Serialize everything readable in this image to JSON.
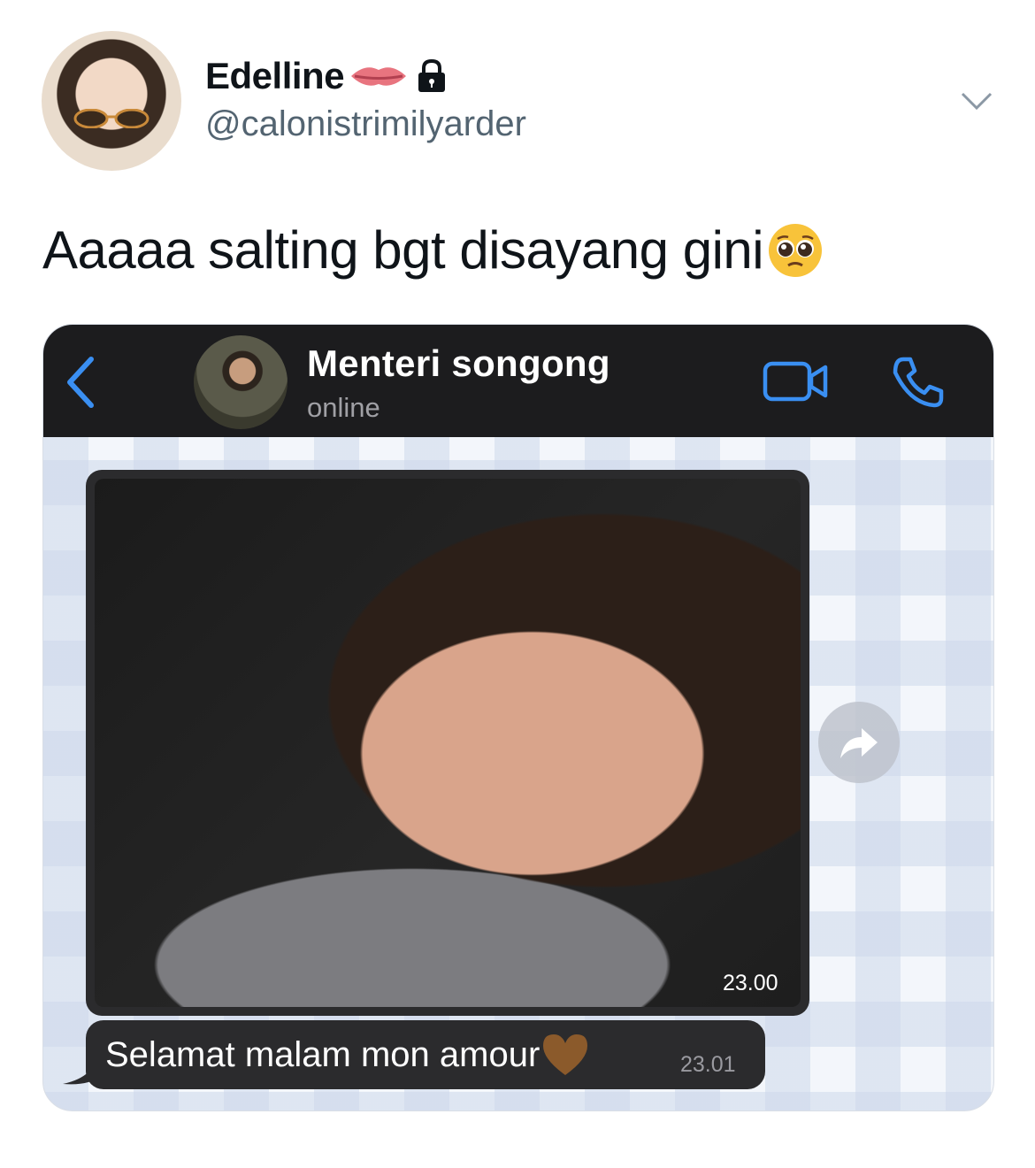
{
  "tweet": {
    "display_name": "Edelline",
    "handle": "@calonistrimilyarder",
    "text": "Aaaaa salting bgt disayang gini",
    "name_icons": [
      "lips-icon",
      "lock-icon"
    ],
    "text_emoji": "pleading-face-icon"
  },
  "chat": {
    "contact_name": "Menteri songong",
    "contact_status": "online",
    "header_icons": [
      "back-icon",
      "video-call-icon",
      "phone-icon"
    ],
    "accent_color": "#3a8ff2",
    "messages": [
      {
        "type": "image",
        "time": "23.00"
      },
      {
        "type": "text",
        "text": "Selamat malam mon amour",
        "emoji": "brown-heart-icon",
        "time": "23.01"
      }
    ]
  }
}
